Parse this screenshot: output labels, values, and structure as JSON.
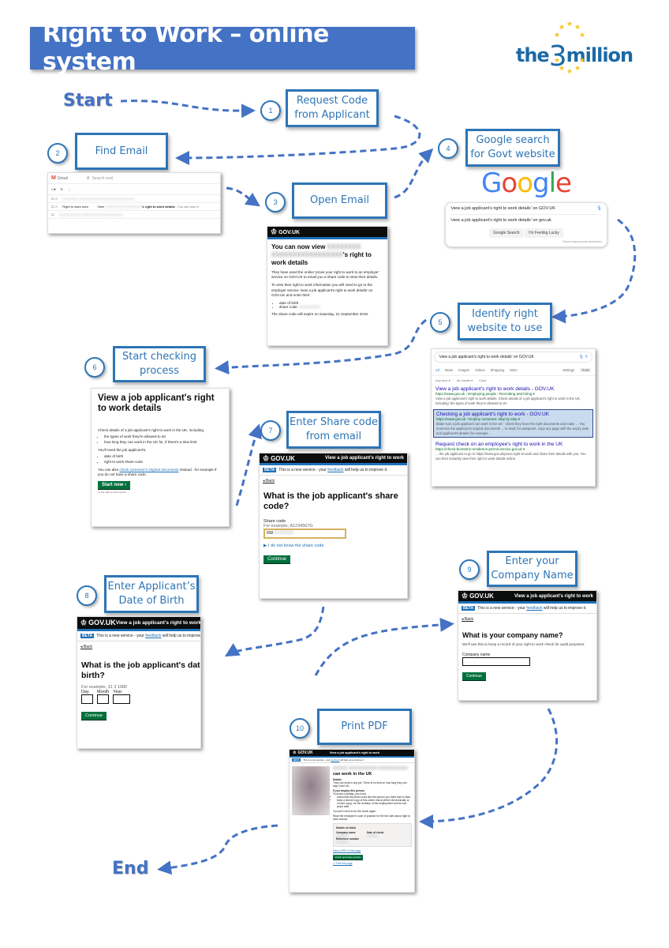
{
  "title": "Right to Work – online system",
  "logo": {
    "prefix": "the",
    "number": "3",
    "suffix": "million",
    "star_color": "#f5c518",
    "text_color": "#1b6aa5"
  },
  "terminals": {
    "start": "Start",
    "end": "End"
  },
  "colors": {
    "banner": "#4472c4",
    "step_border": "#2e75b6",
    "arrow": "#4472c4",
    "gov_green": "#00703c",
    "gov_blue": "#1d70b8"
  },
  "steps": [
    {
      "number": "1",
      "lines": [
        "Request Code",
        "from Applicant"
      ]
    },
    {
      "number": "2",
      "lines": [
        "Find Email"
      ]
    },
    {
      "number": "3",
      "lines": [
        "Open Email"
      ]
    },
    {
      "number": "4",
      "lines": [
        "Google search",
        "for Govt website"
      ]
    },
    {
      "number": "5",
      "lines": [
        "Identify right",
        "website to use"
      ]
    },
    {
      "number": "6",
      "lines": [
        "Start checking",
        "process"
      ]
    },
    {
      "number": "7",
      "lines": [
        "Enter Share code",
        "from email"
      ]
    },
    {
      "number": "8",
      "lines": [
        "Enter Applicant’s",
        "Date of Birth"
      ]
    },
    {
      "number": "9",
      "lines": [
        "Enter your",
        "Company Name"
      ]
    },
    {
      "number": "10",
      "lines": [
        "Print PDF"
      ]
    }
  ],
  "gmail": {
    "app_name": "Gmail",
    "search_placeholder": "Search mail",
    "sender": "Right to work servi",
    "subject": "View ",
    "subject_blurred": "XXXXXX XXXXXXXXXXX",
    "subject_rest": "'s right to work details",
    "snippet": " - You can now vi"
  },
  "email": {
    "brand": "GOV.UK",
    "heading_prefix": "You can now view",
    "heading_blurred": "XXXXXXXX XXXXXXXXXXXXXXXXX",
    "heading_suffix": "'s right to work details",
    "p1": "They have used the online 'prove your right to work to an employer' service on GOV.UK to email you a share code to view their details.",
    "p2": "To view their right to work information you will need to go to the employer service 'view a job applicant's right to work details' on GOV.UK and enter their:",
    "bullets": [
      "date of birth",
      "share code"
    ],
    "share_code_blurred": "XXXXXXXXX",
    "expiry": "The share code will expire on Saturday, 21 September 2019."
  },
  "google": {
    "logo_letters": [
      {
        "ch": "G",
        "color": "#4285f4"
      },
      {
        "ch": "o",
        "color": "#ea4335"
      },
      {
        "ch": "o",
        "color": "#fbbc05"
      },
      {
        "ch": "g",
        "color": "#4285f4"
      },
      {
        "ch": "l",
        "color": "#34a853"
      },
      {
        "ch": "e",
        "color": "#ea4335"
      }
    ],
    "query": "'view a job applicant's right to work details' on GOV.UK",
    "suggestion": "'view a job applicant's right to work details' on gov.uk",
    "buttons": [
      "Google Search",
      "I'm Feeling Lucky"
    ],
    "report": "Report inappropriate predictions"
  },
  "search_results": {
    "query": "'view a job applicant's right to work details' on GOV.UK",
    "tabs": [
      "All",
      "News",
      "Images",
      "Videos",
      "Shopping",
      "More",
      "Settings",
      "Tools"
    ],
    "filters": [
      "Any time ▾",
      "All results ▾",
      "Clear"
    ],
    "results": [
      {
        "title": "View a job applicant's right to work details - GOV.UK",
        "url": "https://www.gov.uk › Employing people › Recruiting and hiring ▾",
        "snippet": "View a job applicant's right to work details. Check details of a job applicant's right to work in the UK, including: the types of work they're allowed to do.",
        "highlighted": false
      },
      {
        "title": "Checking a job applicant's right to work - GOV.UK",
        "url": "https://www.gov.uk › Employ someone: step by step ▾",
        "snippet": "Make sure a job applicant can work in the UK - check they have the right documents and make ... You must see the applicant's original documents ... to read; for passports, copy any page with the expiry date and applicant's details (for example ...",
        "highlighted": true
      },
      {
        "title": "Request check on an employee's right to work in the UK",
        "url": "https://check-biometric-residence-permit.service.gov.uk ▾",
        "snippet": "... the job applicant to go to https://www.gov.uk/prove-right-to-work and share their details with you. You can then instantly view their right to work details online.",
        "highlighted": false
      }
    ]
  },
  "start_page": {
    "heading": "View a job applicant's right to work details",
    "intro": "Check details of a job applicant's right to work in the UK, including:",
    "bullets1": [
      "the types of work they're allowed to do",
      "how long they can work in the UK for, if there's a time limit"
    ],
    "need": "You'll need the job applicant's:",
    "bullets2": [
      "date of birth",
      "right to work share code"
    ],
    "also_prefix": "You can also ",
    "also_link": "check someone's original documents",
    "also_suffix": " instead - for example if you do not have a share code.",
    "button": "Start now ›",
    "button_note": "on the right to work service"
  },
  "service": {
    "brand": "GOV.UK",
    "service_name": "View a job applicant's right to work",
    "beta_tag": "BETA",
    "beta_prefix": "This is a new service - your ",
    "beta_link": "feedback",
    "beta_suffix": " will help us to improve it.",
    "back": "◂ Back",
    "continue": "Continue"
  },
  "share_code_page": {
    "heading": "What is the job applicant's share code?",
    "label": "Share code",
    "hint": "For example, A1234567G",
    "value_visible": "6W",
    "value_blurred": "XXXXXXX",
    "details_link": "I do not know the share code"
  },
  "dob_page": {
    "heading": "What is the job applicant's date of birth?",
    "hint": "For example, 31 3 1980",
    "fields": [
      "Day",
      "Month",
      "Year"
    ]
  },
  "company_page": {
    "heading": "What is your company name?",
    "hint": "We'll use this to keep a record of your right to work check for audit purposes.",
    "label": "Company name"
  },
  "result_page": {
    "heading_blurred": "XXXXX XXXXXXXXXX XXXXXXXXXX",
    "heading_suffix": "can work in the UK",
    "details_label": "Details",
    "details_text": "They can work in any job. There is no limit on how long they can stay in the UK.",
    "employ_heading": "If you employ this person",
    "employ_text": "To avoid a penalty, you must:",
    "bullets": [
      "check that the photo looks like the person you meet face to face",
      "keep a secure copy of this online check (either electronically or in hard copy), for the duration of the employment and for two years after"
    ],
    "no_need": "You don't need to do the check again.",
    "read_more": "Read the employer's code of practice for the full rules about right to work checks.",
    "check_box_title": "Details of check",
    "company_label": "Company name",
    "date_label": "Date of check",
    "ref_label": "Reference number",
    "pdf_link": "View a PDF of this page",
    "button": "Finish and leave service",
    "print_link": "Print this page"
  }
}
